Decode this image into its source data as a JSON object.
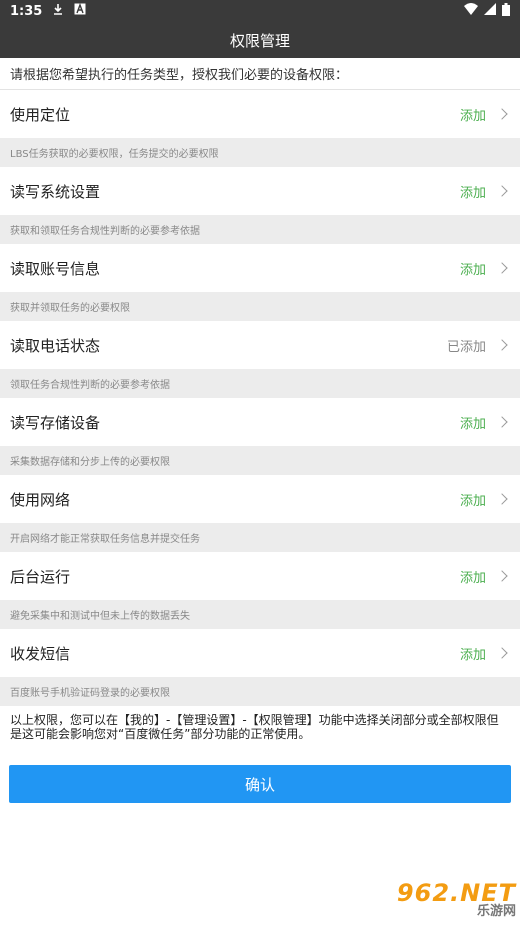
{
  "status_bar": {
    "time": "1:35",
    "icons_left": [
      "download-icon",
      "notification-a-icon"
    ],
    "icons_right": [
      "wifi-icon",
      "signal-icon",
      "battery-icon"
    ]
  },
  "header": {
    "title": "权限管理"
  },
  "intro_text": "请根据您希望执行的任务类型，授权我们必要的设备权限：",
  "permissions": [
    {
      "name": "使用定位",
      "status": "添加",
      "desc": "LBS任务获取的必要权限，任务提交的必要权限"
    },
    {
      "name": "读写系统设置",
      "status": "添加",
      "desc": "获取和领取任务合规性判断的必要参考依据"
    },
    {
      "name": "读取账号信息",
      "status": "添加",
      "desc": "获取并领取任务的必要权限"
    },
    {
      "name": "读取电话状态",
      "status": "已添加",
      "desc": "领取任务合规性判断的必要参考依据"
    },
    {
      "name": "读写存储设备",
      "status": "添加",
      "desc": "采集数据存储和分步上传的必要权限"
    },
    {
      "name": "使用网络",
      "status": "添加",
      "desc": "开启网络才能正常获取任务信息并提交任务"
    },
    {
      "name": "后台运行",
      "status": "添加",
      "desc": "避免采集中和测试中但未上传的数据丢失"
    },
    {
      "name": "收发短信",
      "status": "添加",
      "desc": "百度账号手机验证码登录的必要权限"
    }
  ],
  "footer_note": "以上权限，您可以在【我的】-【管理设置】-【权限管理】功能中选择关闭部分或全部权限但是这可能会影响您对“百度微任务”部分功能的正常使用。",
  "confirm_label": "确认",
  "watermark": {
    "top": "962.NET",
    "bottom": "乐游网"
  },
  "colors": {
    "header_bg": "#3a3a3a",
    "add_green": "#4caf50",
    "button_blue": "#2196f3"
  }
}
